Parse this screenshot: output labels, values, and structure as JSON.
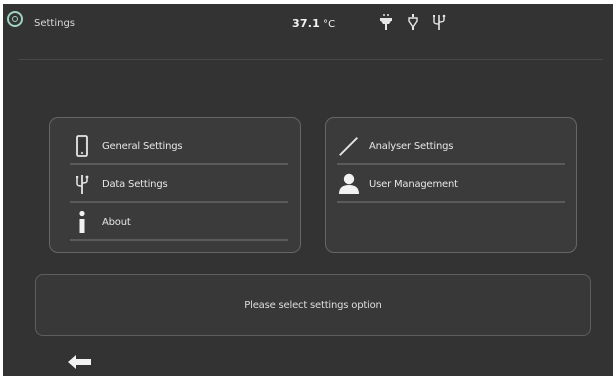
{
  "header": {
    "title": "Settings",
    "temperature": "37.1",
    "temperature_unit": "°C",
    "status_icons": [
      "heater-icon",
      "probe-icon",
      "usb-icon"
    ]
  },
  "menu_left": [
    {
      "label": "General Settings",
      "icon": "tablet-icon"
    },
    {
      "label": "Data Settings",
      "icon": "usb-icon"
    },
    {
      "label": "About",
      "icon": "info-icon"
    }
  ],
  "menu_right": [
    {
      "label": "Analyser Settings",
      "icon": "wand-icon"
    },
    {
      "label": "User Management",
      "icon": "user-icon"
    }
  ],
  "message": "Please select settings option",
  "navigation": {
    "back_icon": "arrow-left-icon"
  },
  "colors": {
    "background": "#333333",
    "panel": "#3b3b3b",
    "panel_border": "#666666",
    "text": "#e6e6e6",
    "logo_accent": "#9fd3c4"
  }
}
